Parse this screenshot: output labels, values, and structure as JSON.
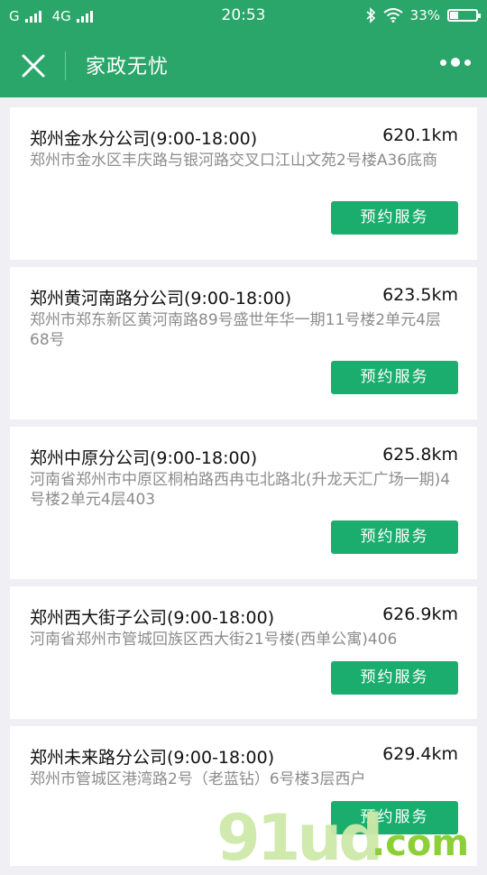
{
  "status_bar": {
    "carrier1": "G",
    "carrier2": "4G",
    "time": "20:53",
    "battery": "33%"
  },
  "header": {
    "title": "家政无忧"
  },
  "stores": [
    {
      "name": "郑州金水分公司(9:00-18:00)",
      "distance": "620.1km",
      "address": "郑州市金水区丰庆路与银河路交叉口江山文苑2号楼A36底商",
      "button": "预约服务"
    },
    {
      "name": "郑州黄河南路分公司(9:00-18:00)",
      "distance": "623.5km",
      "address": "郑州市郑东新区黄河南路89号盛世年华一期11号楼2单元4层68号",
      "button": "预约服务"
    },
    {
      "name": "郑州中原分公司(9:00-18:00)",
      "distance": "625.8km",
      "address": "河南省郑州市中原区桐柏路西冉屯北路北(升龙天汇广场一期)4号楼2单元4层403",
      "button": "预约服务"
    },
    {
      "name": "郑州西大街子公司(9:00-18:00)",
      "distance": "626.9km",
      "address": "河南省郑州市管城回族区西大街21号楼(西单公寓)406",
      "button": "预约服务"
    },
    {
      "name": "郑州未来路分公司(9:00-18:00)",
      "distance": "629.4km",
      "address": "郑州市管城区港湾路2号（老蓝钻）6号楼3层西户",
      "button": "预约服务"
    }
  ],
  "watermark": {
    "part1": "91ud",
    "part2": ".com"
  }
}
